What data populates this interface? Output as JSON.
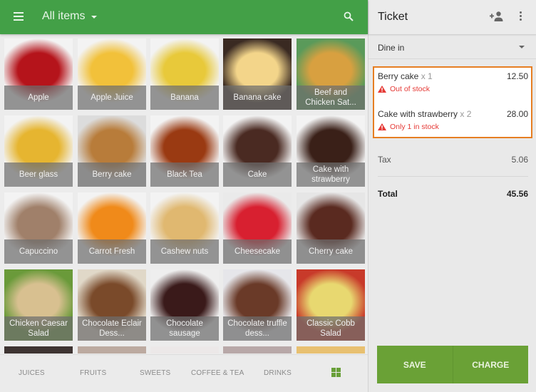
{
  "header": {
    "title": "All items",
    "menu_icon": "hamburger-menu-icon",
    "dropdown_icon": "caret-down-icon",
    "search_icon": "search-icon"
  },
  "items": [
    {
      "name": "Apple",
      "colors": [
        "#f3f3f3",
        "#b5141b"
      ]
    },
    {
      "name": "Apple Juice",
      "colors": [
        "#f3f3f3",
        "#f2c13a"
      ]
    },
    {
      "name": "Banana",
      "colors": [
        "#f3f3f3",
        "#e8c93a"
      ]
    },
    {
      "name": "Banana cake",
      "colors": [
        "#3a2a22",
        "#f3d58a"
      ]
    },
    {
      "name": "Beef and Chicken Sat...",
      "colors": [
        "#5a9a5a",
        "#d8a040"
      ]
    },
    {
      "name": "Beer glass",
      "colors": [
        "#f3f3f3",
        "#e6b530"
      ]
    },
    {
      "name": "Berry cake",
      "colors": [
        "#dcdcdc",
        "#b87c3a"
      ]
    },
    {
      "name": "Black Tea",
      "colors": [
        "#f3f3f3",
        "#9a3a12"
      ]
    },
    {
      "name": "Cake",
      "colors": [
        "#f3f3f3",
        "#4a2a22"
      ]
    },
    {
      "name": "Cake with strawberry",
      "colors": [
        "#f3f3f3",
        "#3a2018"
      ]
    },
    {
      "name": "Capuccino",
      "colors": [
        "#f3f3f3",
        "#a0806a"
      ]
    },
    {
      "name": "Carrot Fresh",
      "colors": [
        "#f3f3f3",
        "#f08a1a"
      ]
    },
    {
      "name": "Cashew nuts",
      "colors": [
        "#f3f3f3",
        "#e0b870"
      ]
    },
    {
      "name": "Cheesecake",
      "colors": [
        "#eaeaea",
        "#d82030"
      ]
    },
    {
      "name": "Cherry cake",
      "colors": [
        "#e6e6e6",
        "#5a2a20"
      ]
    },
    {
      "name": "Chicken Caesar Salad",
      "colors": [
        "#6a9a3a",
        "#d8c090"
      ]
    },
    {
      "name": "Chocolate Eclair Dess...",
      "colors": [
        "#e0d8c8",
        "#7a4a2a"
      ]
    },
    {
      "name": "Chocolate sausage",
      "colors": [
        "#eeeeee",
        "#3a1a1a"
      ]
    },
    {
      "name": "Chocolate truffle dess...",
      "colors": [
        "#e6e6ea",
        "#6a3a28"
      ]
    },
    {
      "name": "Classic Cobb Salad",
      "colors": [
        "#c83a2a",
        "#e8d870"
      ]
    }
  ],
  "partial_row_colors": [
    "#3e3432",
    "#bcaaa0",
    "#ece8e8",
    "#b8a8a8",
    "#e8c070"
  ],
  "categories": [
    {
      "label": "JUICES"
    },
    {
      "label": "FRUITS"
    },
    {
      "label": "SWEETS"
    },
    {
      "label": "COFFEE & TEA"
    },
    {
      "label": "DRINKS"
    }
  ],
  "category_grid_icon": "grid-view-icon",
  "ticket": {
    "title": "Ticket",
    "add_customer_icon": "add-person-icon",
    "more_icon": "more-vert-icon",
    "dining_option": "Dine in",
    "lines": [
      {
        "name": "Berry cake",
        "qty": "x 1",
        "price": "12.50",
        "warning": "Out of stock"
      },
      {
        "name": "Cake with strawberry",
        "qty": "x 2",
        "price": "28.00",
        "warning": "Only 1 in stock"
      }
    ],
    "tax_label": "Tax",
    "tax_value": "5.06",
    "total_label": "Total",
    "total_value": "45.56",
    "save_label": "SAVE",
    "charge_label": "CHARGE"
  },
  "colors": {
    "primary_green": "#43a047",
    "action_green": "#6aa136",
    "warning_red": "#e53935",
    "highlight_orange": "#e67e22"
  }
}
